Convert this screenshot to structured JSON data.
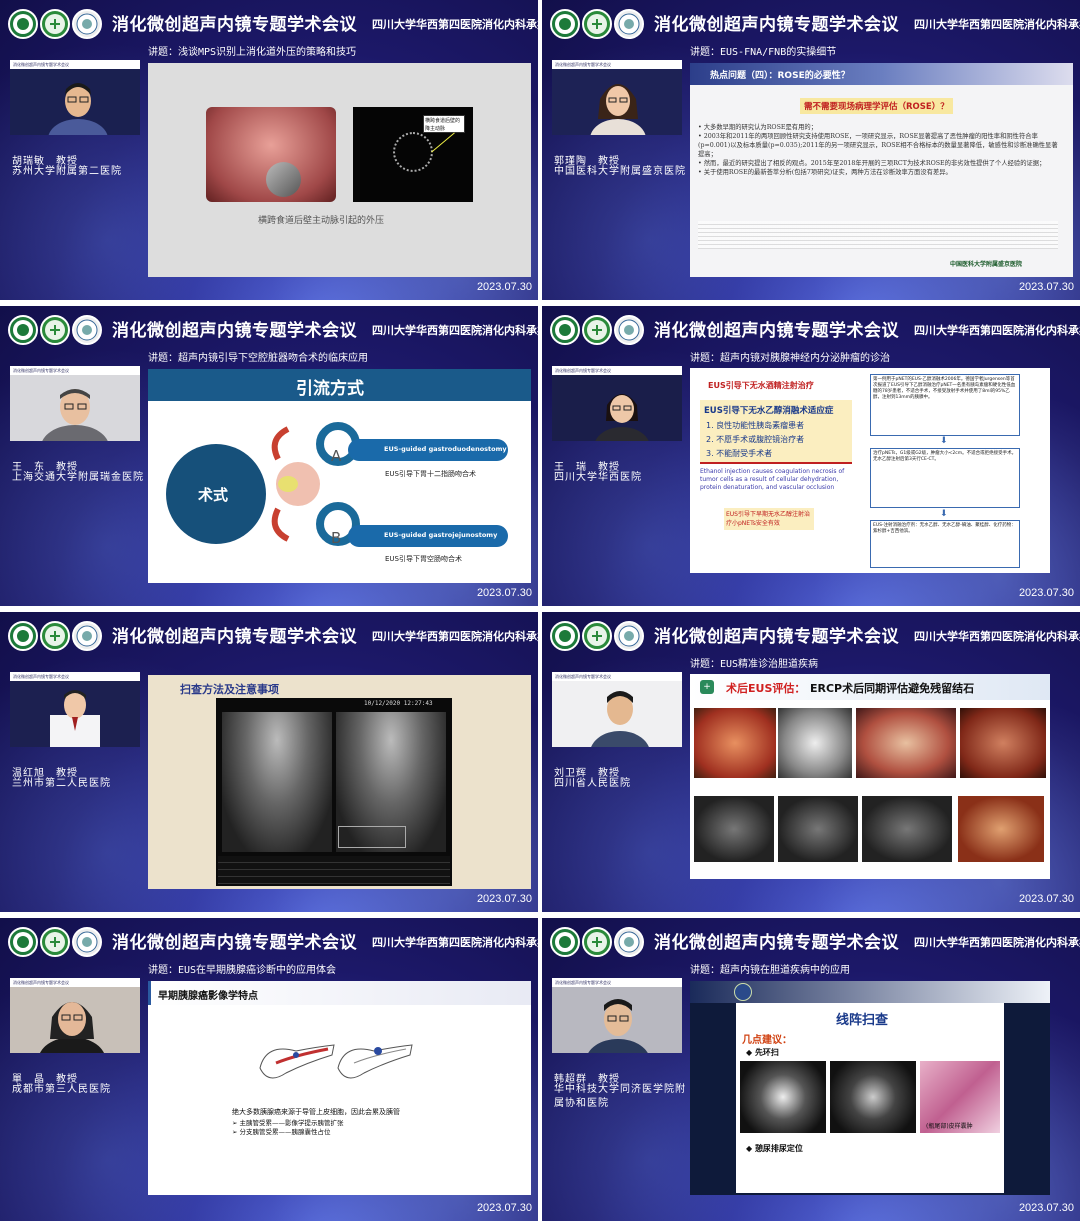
{
  "header": {
    "conference_title": "消化微创超声内镜专题学术会议",
    "organizer": "四川大学华西第四医院消化内科承办",
    "date": "2023.07.30",
    "camera_bar_text": "消化微创超声内镜专题学术会议"
  },
  "panels": [
    {
      "lecture": "讲题：浅谈MPS识别上消化道外压的策略和技巧",
      "speaker_name": "胡瑞敏　教授",
      "speaker_affiliation": "苏州大学附属第二医院",
      "slide": {
        "inset_label": "横跨食道后壁的降主动脉",
        "caption": "横跨食道后壁主动脉引起的外压"
      }
    },
    {
      "lecture": "讲题：EUS-FNA/FNB的实操细节",
      "speaker_name": "郭瑾陶　教授",
      "speaker_affiliation": "中国医科大学附属盛京医院",
      "slide": {
        "title": "热点问题（四）：ROSE的必要性？",
        "question": "需不需要现场病理学评估（ROSE）？",
        "bullets": [
          "大多数早期的研究认为ROSE是有用的；",
          "2003年和2011年的两项回顾性研究支持使用ROSE，一项研究显示，ROSE显著提高了恶性肿瘤的阳性率和阴性符合率(p=0.001)以及标本质量(p=0.035);2011年的另一项研究显示，ROSE相不合格标本的数量显著降低，敏感性和诊断准确性显著提高；",
          "然而，最近的研究提出了相反的观点。2015年至2018年开展的三项RCT为技术ROSE的非劣效性提供了个人经验的证据；",
          "关于使用ROSE的最新荟萃分析(包括7项研究)证实，两种方法在诊断效率方面没有差异。"
        ],
        "hospital": "中国医科大学附属盛京医院"
      }
    },
    {
      "lecture": "讲题：超声内镜引导下空腔脏器吻合术的临床应用",
      "speaker_name": "王　东　教授",
      "speaker_affiliation": "上海交通大学附属瑞金医院",
      "slide": {
        "title": "引流方式",
        "center": "术式",
        "a_label": "A",
        "b_label": "B",
        "a_en": "EUS-guided gastroduodenostomy",
        "a_cn": "EUS引导下胃十二指肠吻合术",
        "b_en": "EUS-guided gastrojejunostomy",
        "b_cn": "EUS引导下胃空肠吻合术"
      }
    },
    {
      "lecture": "讲题：超声内镜对胰腺神经内分泌肿瘤的诊治",
      "speaker_name": "王　瑞　教授",
      "speaker_affiliation": "四川大学华西医院",
      "slide": {
        "title": "EUS引导下无水酒精注射治疗",
        "box_title": "EUS引导下无水乙醇消融术适应症",
        "items": [
          "1.  良性功能性胰岛素瘤患者",
          "2.  不愿手术或腹腔镜治疗者",
          "3.  不能耐受手术者"
        ],
        "en_text": "Ethanol injection causes coagulation necrosis of tumor cells as a result of cellular dehydration, protein denaturation, and vascular occlusion",
        "red_box": "EUS引导下早期无水乙醇注射治疗小pNETs安全有效",
        "right_text_1": "第一例用于pNET的EUS-乙醇消融术2006年。德国学者Jurgensen等首次报道了EUS引导下乙醇消融治疗pNET一名患有胰岛素瘤和硬化性低血糖的78岁患者，不适合手术，不接受放射手术并使用了8ml的95%乙醇，注射到13mm的胰腺中。",
        "right_text_2": "治疗pNETs，G1级或G2级，肿瘤大小<2cm。不适合或拒绝接受手术。无水乙醇注射后第3天行CE-CT。",
        "right_text_3": "EUS-注射消融治疗剂：无水乙醇、无水乙醇-碘油、聚桂醇、化疗药物：紫杉醇+吉西他滨。"
      }
    },
    {
      "lecture": "",
      "speaker_name": "温红旭　教授",
      "speaker_affiliation": "兰州市第二人民医院",
      "slide": {
        "title": "扫查方法及注意事项",
        "timestamp": "10/12/2020 12:27:43"
      }
    },
    {
      "lecture": "讲题：EUS精准诊治胆道疾病",
      "speaker_name": "刘卫辉　教授",
      "speaker_affiliation": "四川省人民医院",
      "slide": {
        "title_red": "术后EUS评估：",
        "title_black": "ERCP术后同期评估避免残留结石"
      }
    },
    {
      "lecture": "讲题：EUS在早期胰腺癌诊断中的应用体会",
      "speaker_name": "單　晶　教授",
      "speaker_affiliation": "成都市第三人民医院",
      "slide": {
        "title": "早期胰腺癌影像学特点",
        "text_main": "绝大多数胰腺癌来源于导管上皮细胞，因此会累及胰管",
        "bullet1": "主胰管受累——影像学提示胰管扩张",
        "bullet2": "分支胰管受累——胰腺囊性占位"
      }
    },
    {
      "lecture": "讲题：超声内镜在胆道疾病中的应用",
      "speaker_name": "韩超群　教授",
      "speaker_affiliation": "华中科技大学同济医学院附属协和医院",
      "slide": {
        "title": "线阵扫查",
        "subtitle": "几点建议：",
        "point1": "先环扫",
        "point2": "憩尿排尿定位",
        "path_caption": "(瓶尾部)皮样囊肿"
      }
    }
  ]
}
